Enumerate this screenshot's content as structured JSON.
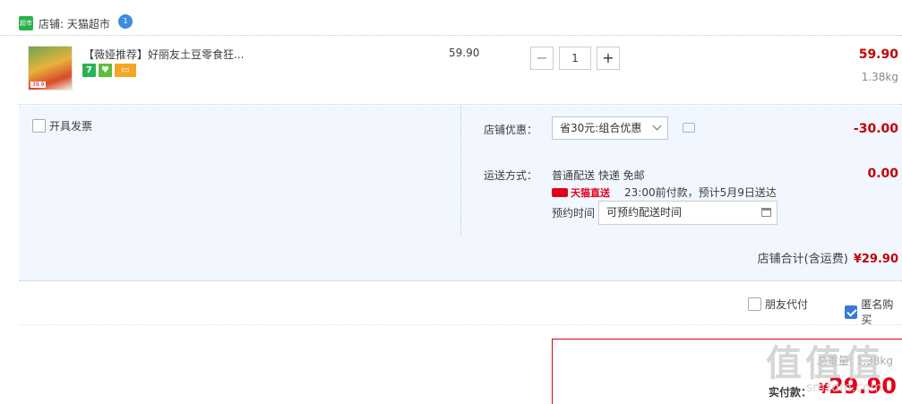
{
  "store": {
    "icon_text": "超市",
    "label": "店铺: ",
    "name": "天猫超市",
    "ww_icon_text": "1"
  },
  "item": {
    "thumb_tag": "39.9",
    "title": "【薇娅推荐】好丽友土豆零食狂...",
    "badges": [
      {
        "name": "seven-day-return-icon",
        "text": "7"
      },
      {
        "name": "shield-icon",
        "text": "♥"
      },
      {
        "name": "card-icon",
        "text": "▭"
      }
    ],
    "unit_price": "59.90",
    "quantity": "1",
    "minus": "−",
    "plus": "+",
    "sum_price": "59.90",
    "weight": "1.38kg"
  },
  "invoice": {
    "label": "开具发票",
    "checked": false
  },
  "promo": {
    "label": "店铺优惠：",
    "selected": "省30元:组合优惠",
    "amount": "-30.00"
  },
  "shipping": {
    "label": "运送方式：",
    "method": "普通配送 快递 免邮",
    "carrier": "天猫直送",
    "eta": "23:00前付款，预计5月9日送达",
    "amount": "0.00",
    "appointment_label": "预约时间",
    "appointment_placeholder": "可预约配送时间"
  },
  "store_total": {
    "label": "店铺合计(含运费)",
    "amount": "¥29.90"
  },
  "options": {
    "friend_pay": "朋友代付",
    "anonymous": "匿名购买"
  },
  "pay": {
    "weight": "总重量: 1.38kg",
    "label": "实付款：",
    "currency": "¥",
    "amount": "29.90"
  },
  "watermark": {
    "text": "值值值",
    "url": "smzdm.com"
  },
  "colors": {
    "price_red": "#c40000",
    "tmall_red": "#e4001b",
    "panel_bg": "#f2f7ff",
    "check_blue": "#3a7bd5"
  }
}
